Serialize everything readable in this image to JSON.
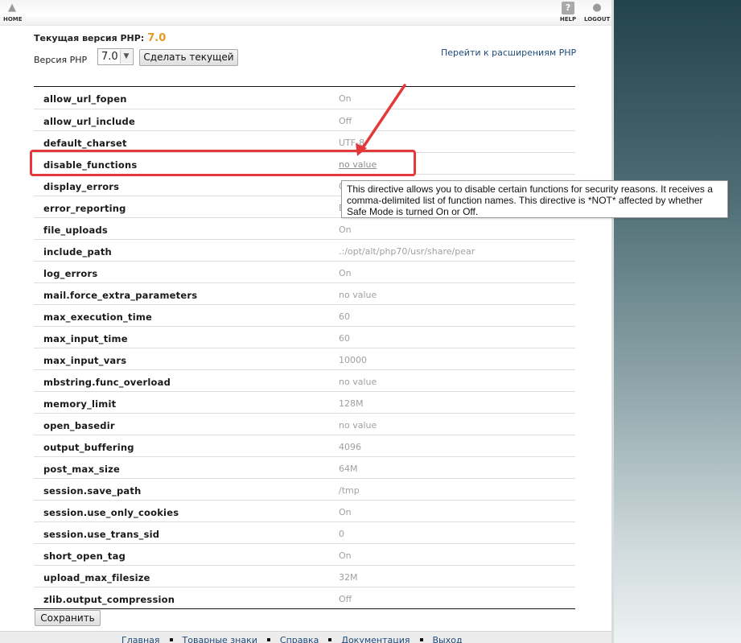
{
  "topbar": {
    "home_label": "HOME",
    "help_label": "HELP",
    "logout_label": "LOGOUT"
  },
  "php_version": {
    "current_label": "Текущая версия PHP:",
    "current_value": "7.0",
    "select_label": "Версия PHP",
    "selected_version": "7.0",
    "make_current_button": "Сделать текущей",
    "extensions_link": "Перейти к расширениям PHP"
  },
  "options": [
    {
      "name": "allow_url_fopen",
      "value": "On"
    },
    {
      "name": "allow_url_include",
      "value": "Off"
    },
    {
      "name": "default_charset",
      "value": "UTF-8"
    },
    {
      "name": "disable_functions",
      "value": "no value"
    },
    {
      "name": "display_errors",
      "value": "On"
    },
    {
      "name": "error_reporting",
      "value": "E_ALL"
    },
    {
      "name": "file_uploads",
      "value": "On"
    },
    {
      "name": "include_path",
      "value": ".:/opt/alt/php70/usr/share/pear"
    },
    {
      "name": "log_errors",
      "value": "On"
    },
    {
      "name": "mail.force_extra_parameters",
      "value": "no value"
    },
    {
      "name": "max_execution_time",
      "value": "60"
    },
    {
      "name": "max_input_time",
      "value": "60"
    },
    {
      "name": "max_input_vars",
      "value": "10000"
    },
    {
      "name": "mbstring.func_overload",
      "value": "no value"
    },
    {
      "name": "memory_limit",
      "value": "128M"
    },
    {
      "name": "open_basedir",
      "value": "no value"
    },
    {
      "name": "output_buffering",
      "value": "4096"
    },
    {
      "name": "post_max_size",
      "value": "64M"
    },
    {
      "name": "session.save_path",
      "value": "/tmp"
    },
    {
      "name": "session.use_only_cookies",
      "value": "On"
    },
    {
      "name": "session.use_trans_sid",
      "value": "0"
    },
    {
      "name": "short_open_tag",
      "value": "On"
    },
    {
      "name": "upload_max_filesize",
      "value": "32M"
    },
    {
      "name": "zlib.output_compression",
      "value": "Off"
    }
  ],
  "tooltip": {
    "text": "This directive allows you to disable certain functions for security reasons. It receives a comma-delimited list of function names. This directive is *NOT* affected by whether Safe Mode is turned On or Off."
  },
  "save_button": "Сохранить",
  "footer": {
    "links": [
      "Главная",
      "Товарные знаки",
      "Справка",
      "Документация",
      "Выход"
    ]
  },
  "annotation": {
    "highlight_color": "#e5383b"
  }
}
